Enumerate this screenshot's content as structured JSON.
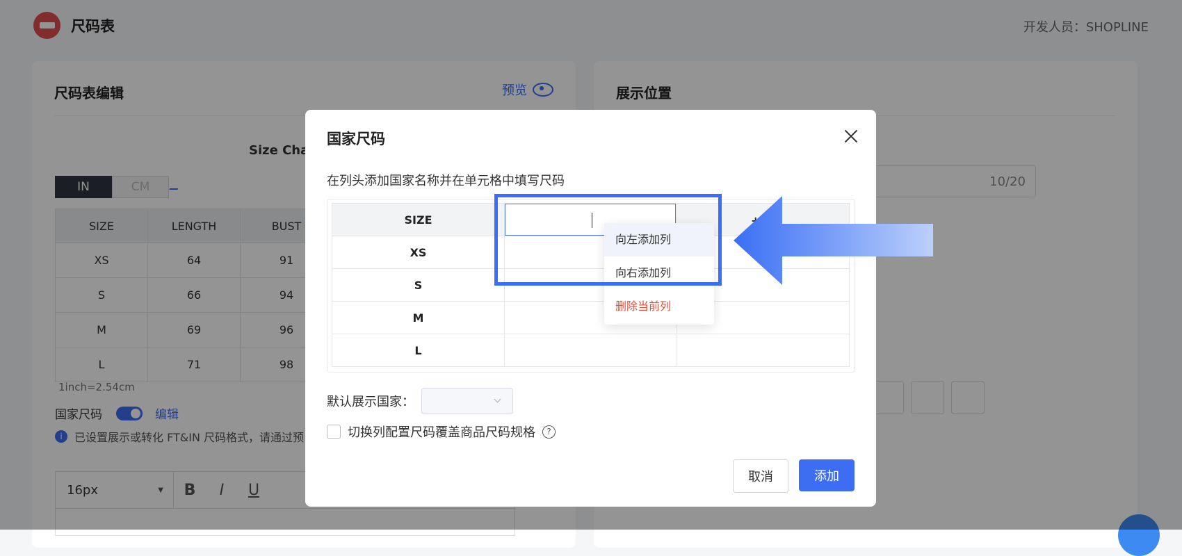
{
  "app": {
    "title": "尺码表",
    "developer": "开发人员：SHOPLINE"
  },
  "editor_card": {
    "title": "尺码表编辑",
    "preview": "预览",
    "chart_title": "Size Char",
    "units": [
      "IN",
      "CM"
    ],
    "table": {
      "headers": [
        "SIZE",
        "LENGTH",
        "BUST"
      ],
      "rows": [
        [
          "XS",
          "64",
          "91"
        ],
        [
          "S",
          "66",
          "94"
        ],
        [
          "M",
          "69",
          "96"
        ],
        [
          "L",
          "71",
          "98"
        ]
      ]
    },
    "conversion": "1inch=2.54cm",
    "country_size_label": "国家尺码",
    "edit_label": "编辑",
    "notice": "已设置展示或转化 FT&IN 尺码格式，请通过预",
    "font_size": "16px",
    "format_buttons": [
      "B",
      "I",
      "U"
    ]
  },
  "position_card": {
    "title": "展示位置",
    "counter": "10/20"
  },
  "modal": {
    "title": "国家尺码",
    "instruction": "在列头添加国家名称并在单元格中填写尺码",
    "size_header": "SIZE",
    "add_column": "+ 国",
    "sizes": [
      "XS",
      "S",
      "M",
      "L"
    ],
    "context_menu": {
      "add_left": "向左添加列",
      "add_right": "向右添加列",
      "delete": "删除当前列"
    },
    "default_country_label": "默认展示国家：",
    "override_label": "切换列配置尺码覆盖商品尺码规格",
    "cancel": "取消",
    "add": "添加"
  },
  "colors": {
    "accent": "#3d6df2",
    "danger": "#e2503c",
    "highlight": "#3a6ff5"
  }
}
